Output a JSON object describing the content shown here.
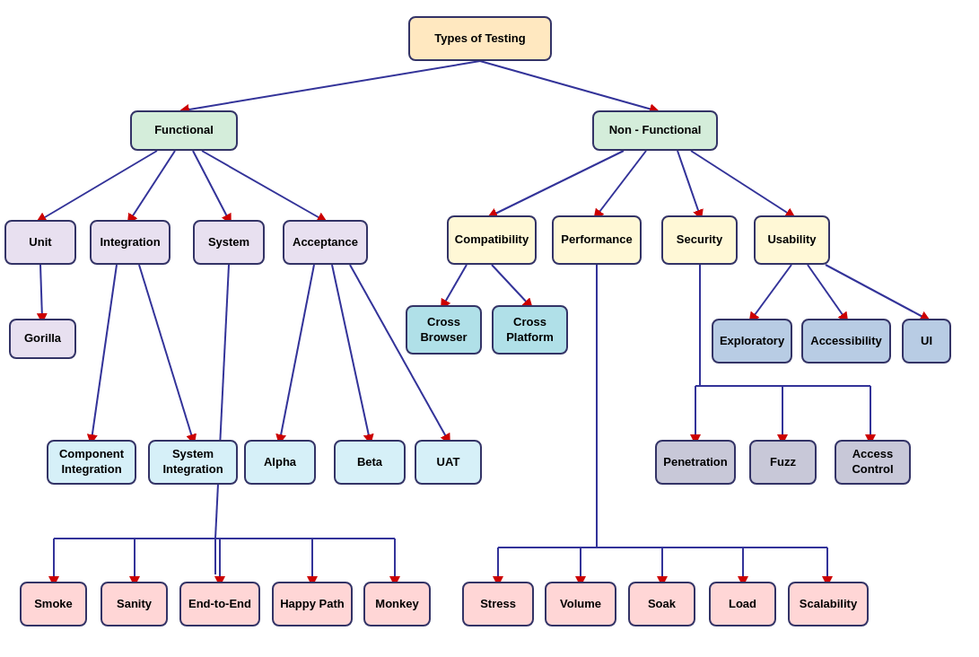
{
  "nodes": {
    "root": "Types of Testing",
    "functional": "Functional",
    "nonfunctional": "Non - Functional",
    "unit": "Unit",
    "integration": "Integration",
    "system": "System",
    "acceptance": "Acceptance",
    "compatibility": "Compatibility",
    "performance": "Performance",
    "security": "Security",
    "usability": "Usability",
    "gorilla": "Gorilla",
    "comp_integration": "Component Integration",
    "sys_integration": "System Integration",
    "alpha": "Alpha",
    "beta": "Beta",
    "uat": "UAT",
    "cross_browser": "Cross Browser",
    "cross_platform": "Cross Platform",
    "exploratory": "Exploratory",
    "accessibility": "Accessibility",
    "ui": "UI",
    "penetration": "Penetration",
    "fuzz": "Fuzz",
    "access_control": "Access Control",
    "smoke": "Smoke",
    "sanity": "Sanity",
    "end_to_end": "End-to-End",
    "happy_path": "Happy Path",
    "monkey": "Monkey",
    "stress": "Stress",
    "volume": "Volume",
    "soak": "Soak",
    "load": "Load",
    "scalability": "Scalability"
  }
}
